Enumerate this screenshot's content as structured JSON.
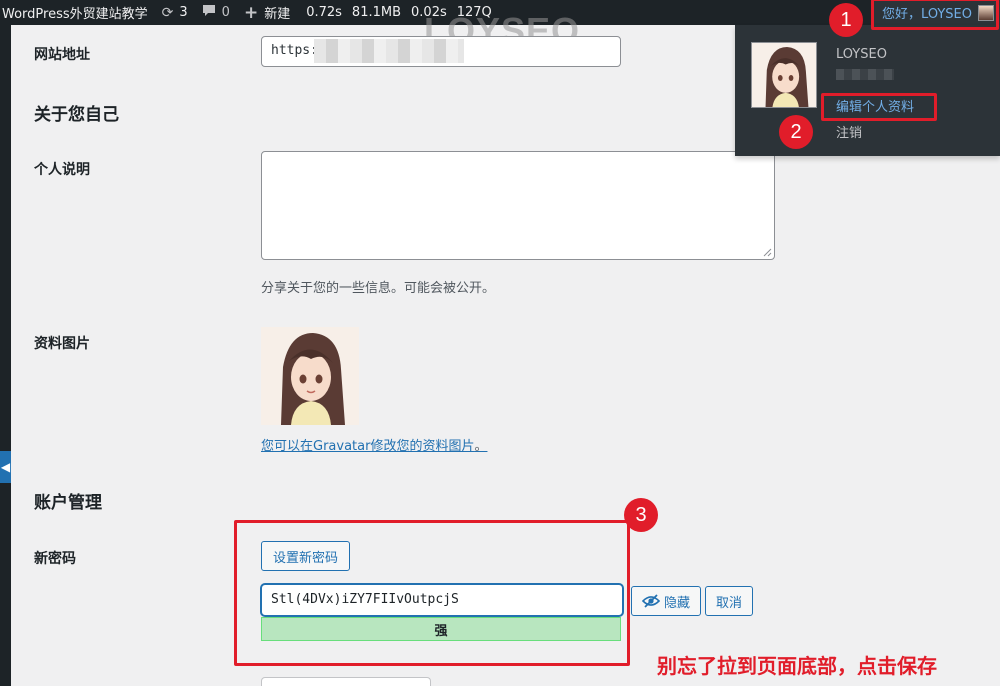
{
  "admin_bar": {
    "site_name": "WordPress外贸建站教学",
    "updates_count": "3",
    "comments_count": "0",
    "new_label": "新建",
    "stats": [
      "0.72s",
      "81.1MB",
      "0.02s",
      "127Q"
    ],
    "howdy": "您好，LOYSEO"
  },
  "watermark": "LOYSEO",
  "user_menu": {
    "display_name": "LOYSEO",
    "edit_profile": "编辑个人资料",
    "logout": "注销"
  },
  "form": {
    "website": {
      "label": "网站地址",
      "value": "https:"
    },
    "about_section": "关于您自己",
    "bio": {
      "label": "个人说明",
      "description": "分享关于您的一些信息。可能会被公开。"
    },
    "profile_picture": {
      "label": "资料图片",
      "gravatar_link": "您可以在Gravatar修改您的资料图片",
      "gravatar_tail": "。"
    },
    "account_section": "账户管理",
    "new_password": {
      "label": "新密码",
      "set_button": "设置新密码",
      "value": "Stl(4DVx)iZY7FIIvOutpcjS",
      "strength": "强",
      "hide_button": "隐藏",
      "cancel_button": "取消"
    }
  },
  "annotations": {
    "step1": "1",
    "step2": "2",
    "step3": "3",
    "note": "别忘了拉到页面底部，点击保存"
  },
  "colors": {
    "admin_bar": "#1d2327",
    "link": "#2271b1",
    "highlight": "#e11d2a",
    "strength_strong": "#b8e6bf"
  }
}
